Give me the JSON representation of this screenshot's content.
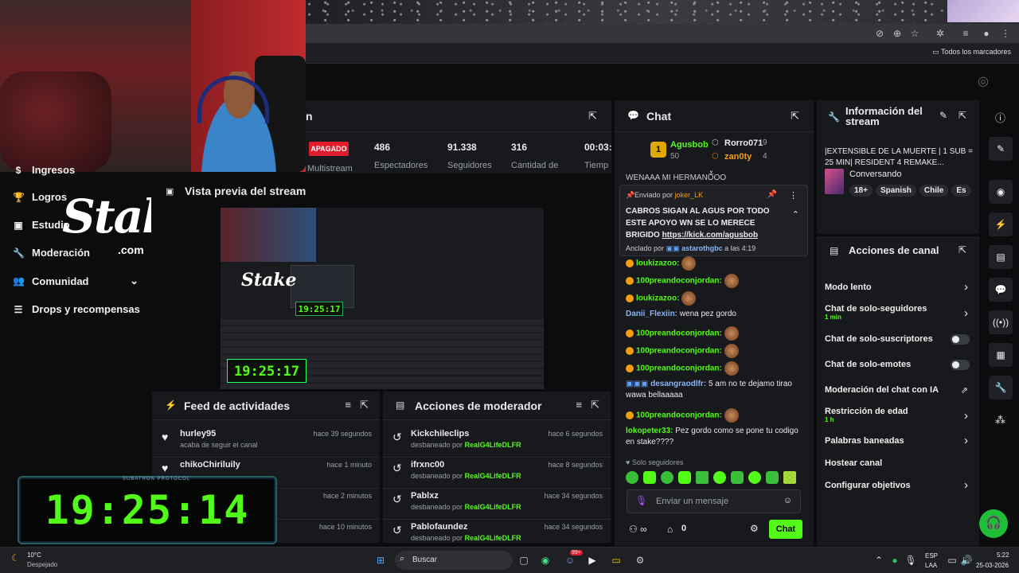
{
  "browser": {
    "bookmarks_label": "Todos los marcadores"
  },
  "sidebar": {
    "items": [
      {
        "label": "Ingresos",
        "icon": "money-icon"
      },
      {
        "label": "Logros",
        "icon": "trophy-icon"
      },
      {
        "label": "Estudio",
        "icon": "studio-icon"
      },
      {
        "label": "Moderación",
        "icon": "wrench-icon"
      },
      {
        "label": "Comunidad",
        "icon": "people-icon"
      },
      {
        "label": "Drops y recompensas",
        "icon": "gift-icon"
      }
    ]
  },
  "overlay": {
    "stake_logo": "Stake",
    "stake_dotcom": ".com"
  },
  "stats": {
    "title_fragment": "n",
    "status_badge": "APAGADO",
    "multistream_label": "Multistream",
    "items": [
      {
        "value": "486",
        "label": "Espectadores"
      },
      {
        "value": "91.338",
        "label": "Seguidores"
      },
      {
        "value": "316",
        "label": "Cantidad de"
      },
      {
        "value": "00:03:",
        "label": "Tiemp"
      }
    ]
  },
  "preview": {
    "title": "Vista previa del stream",
    "small_clock": "19:25:17",
    "big_clock": "19:25:17"
  },
  "feed": {
    "title": "Feed de actividades",
    "rows": [
      {
        "name": "hurley95",
        "sub": "acaba de seguir el canal",
        "time": "hace 39 segundos"
      },
      {
        "name": "chikoChiriluily",
        "sub": "",
        "time": "hace 1 minuto"
      },
      {
        "name": "",
        "sub": "",
        "time": "hace 2 minutos"
      },
      {
        "name": "",
        "sub": "",
        "time": "hace 10 minutos"
      }
    ]
  },
  "mod": {
    "title": "Acciones de moderador",
    "rows": [
      {
        "name": "Kickchileclips",
        "action": "desbaneado por",
        "by": "RealG4LifeDLFR",
        "time": "hace 6 segundos"
      },
      {
        "name": "ifrxnc00",
        "action": "desbaneado por",
        "by": "RealG4LifeDLFR",
        "time": "hace 8 segundos"
      },
      {
        "name": "Pablxz",
        "action": "desbaneado por",
        "by": "RealG4LifeDLFR",
        "time": "hace 34 segundos"
      },
      {
        "name": "Pablofaundez",
        "action": "desbaneado por",
        "by": "RealG4LifeDLFR",
        "time": "hace 34 segundos"
      }
    ]
  },
  "timer": {
    "label": "SUBATHON PROTOCOL",
    "value": "19:25:14"
  },
  "chat": {
    "title": "Chat",
    "leaders": [
      {
        "rank": "1",
        "name": "Agusbob",
        "count": "50"
      },
      {
        "name": "Rorro071",
        "count": "9"
      },
      {
        "name": "zan0ty",
        "count": "4"
      }
    ],
    "top_clip": "WENAAA MI HERMANOOO",
    "pinned": {
      "sent_by_label": "Enviado por",
      "sent_by": "joker_LK",
      "text": "CABROS SIGAN AL AGUS POR TODO ESTE APOYO WN SE LO MERECE BRIGIDO",
      "link": "https://kick.com/agusbob",
      "pinned_by_label": "Anclado por",
      "pinned_by": "astarothgbc",
      "pinned_time": "a las 4:19"
    },
    "messages": [
      {
        "user": "loukizazoo:",
        "text": ""
      },
      {
        "user": "100preandoconjordan:",
        "text": ""
      },
      {
        "user": "loukizazoo:",
        "text": ""
      },
      {
        "user": "Danii_Flexiin:",
        "text": "wena pez gordo"
      },
      {
        "user": "100preandoconjordan:",
        "text": ""
      },
      {
        "user": "100preandoconjordan:",
        "text": ""
      },
      {
        "user": "100preandoconjordan:",
        "text": ""
      },
      {
        "user": "desangraodlfr:",
        "text": "5 am no te dejamo tirao wawa bellaaaaa"
      },
      {
        "user": "100preandoconjordan:",
        "text": ""
      },
      {
        "user": "lokopeter33:",
        "text": "Pez gordo como se pone tu codigo en stake????"
      }
    ],
    "followers_only": "Solo seguidores",
    "input_placeholder": "Enviar un mensaje",
    "send_button": "Chat",
    "points": "0"
  },
  "info": {
    "title": "Información del stream",
    "stream_title": "|EXTENSIBLE DE LA MUERTE | 1 SUB = 25 MIN| RESIDENT 4 REMAKE...",
    "category": "Conversando",
    "tags": [
      "18+",
      "Spanish",
      "Chile",
      "Es"
    ]
  },
  "actions": {
    "title": "Acciones de canal",
    "items": [
      {
        "label": "Modo lento",
        "sub": "",
        "ctrl": "chevron"
      },
      {
        "label": "Chat de solo-seguidores",
        "sub": "1 min",
        "ctrl": "chevron"
      },
      {
        "label": "Chat de solo-suscriptores",
        "sub": "",
        "ctrl": "toggle"
      },
      {
        "label": "Chat de solo-emotes",
        "sub": "",
        "ctrl": "toggle"
      },
      {
        "label": "Moderación del chat con IA",
        "sub": "",
        "ctrl": "external"
      },
      {
        "label": "Restricción de edad",
        "sub": "1 h",
        "ctrl": "chevron"
      },
      {
        "label": "Palabras baneadas",
        "sub": "",
        "ctrl": "chevron"
      },
      {
        "label": "Hostear canal",
        "sub": "",
        "ctrl": "none"
      },
      {
        "label": "Configurar objetivos",
        "sub": "",
        "ctrl": "chevron"
      }
    ]
  },
  "taskbar": {
    "weather_temp": "10°C",
    "weather_desc": "Despejado",
    "search_placeholder": "Buscar",
    "lang1": "ESP",
    "lang2": "LAA",
    "time": "5:22",
    "date": "25-03-2026",
    "discord_badge": "99+"
  },
  "colors": {
    "accent": "#53fc18",
    "live_red": "#e11d2d",
    "panel": "#18191c"
  }
}
